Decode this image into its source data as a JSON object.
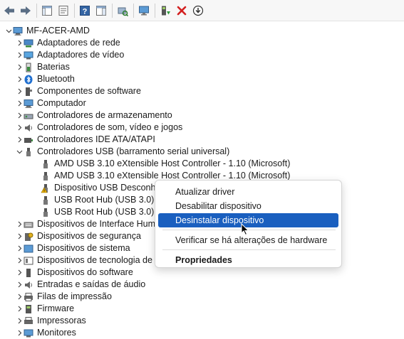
{
  "toolbar": {
    "buttons": [
      {
        "name": "back-icon"
      },
      {
        "name": "forward-icon"
      },
      {
        "name": "show-hide-console-tree-icon"
      },
      {
        "name": "properties-icon"
      },
      {
        "name": "help-icon"
      },
      {
        "name": "action-pane-icon"
      },
      {
        "name": "scan-hardware-icon"
      },
      {
        "name": "monitor-icon"
      },
      {
        "name": "update-driver-icon"
      },
      {
        "name": "uninstall-device-icon"
      },
      {
        "name": "download-icon"
      }
    ]
  },
  "tree": {
    "root": "MF-ACER-AMD",
    "categories_top": [
      {
        "label": "Adaptadores de rede",
        "icon": "network-adapter-icon"
      },
      {
        "label": "Adaptadores de vídeo",
        "icon": "display-adapter-icon"
      },
      {
        "label": "Baterias",
        "icon": "battery-icon"
      },
      {
        "label": "Bluetooth",
        "icon": "bluetooth-icon"
      },
      {
        "label": "Componentes de software",
        "icon": "software-component-icon"
      },
      {
        "label": "Computador",
        "icon": "computer-icon"
      },
      {
        "label": "Controladores de armazenamento",
        "icon": "storage-controller-icon"
      },
      {
        "label": "Controladores de som, vídeo e jogos",
        "icon": "sound-icon"
      },
      {
        "label": "Controladores IDE ATA/ATAPI",
        "icon": "ide-controller-icon"
      }
    ],
    "usb": {
      "label": "Controladores USB (barramento serial universal)",
      "children": [
        {
          "label": "AMD USB 3.10 eXtensible Host Controller - 1.10 (Microsoft)",
          "warning": false
        },
        {
          "label": "AMD USB 3.10 eXtensible Host Controller - 1.10 (Microsoft)",
          "warning": false
        },
        {
          "label": "Dispositivo USB Desconheci",
          "warning": true
        },
        {
          "label": "USB Root Hub (USB 3.0)",
          "warning": false
        },
        {
          "label": "USB Root Hub (USB 3.0)",
          "warning": false
        }
      ]
    },
    "categories_bottom": [
      {
        "label": "Dispositivos de Interface Huma",
        "icon": "hid-icon"
      },
      {
        "label": "Dispositivos de segurança",
        "icon": "security-device-icon"
      },
      {
        "label": "Dispositivos de sistema",
        "icon": "system-device-icon"
      },
      {
        "label": "Dispositivos de tecnologia de m",
        "icon": "memory-tech-icon"
      },
      {
        "label": "Dispositivos do software",
        "icon": "software-device-icon"
      },
      {
        "label": "Entradas e saídas de áudio",
        "icon": "audio-io-icon"
      },
      {
        "label": "Filas de impressão",
        "icon": "print-queue-icon"
      },
      {
        "label": "Firmware",
        "icon": "firmware-icon"
      },
      {
        "label": "Impressoras",
        "icon": "printer-icon"
      },
      {
        "label": "Monitores",
        "icon": "monitor-icon"
      }
    ]
  },
  "context_menu": {
    "update_driver": "Atualizar driver",
    "disable_device": "Desabilitar dispositivo",
    "uninstall_device": "Desinstalar dispositivo",
    "scan_changes": "Verificar se há alterações de hardware",
    "properties": "Propriedades"
  },
  "colors": {
    "selection": "#1a5fbf",
    "warning": "#f2b705",
    "uninstall_red": "#d32020",
    "update_green": "#2e9b3a"
  }
}
